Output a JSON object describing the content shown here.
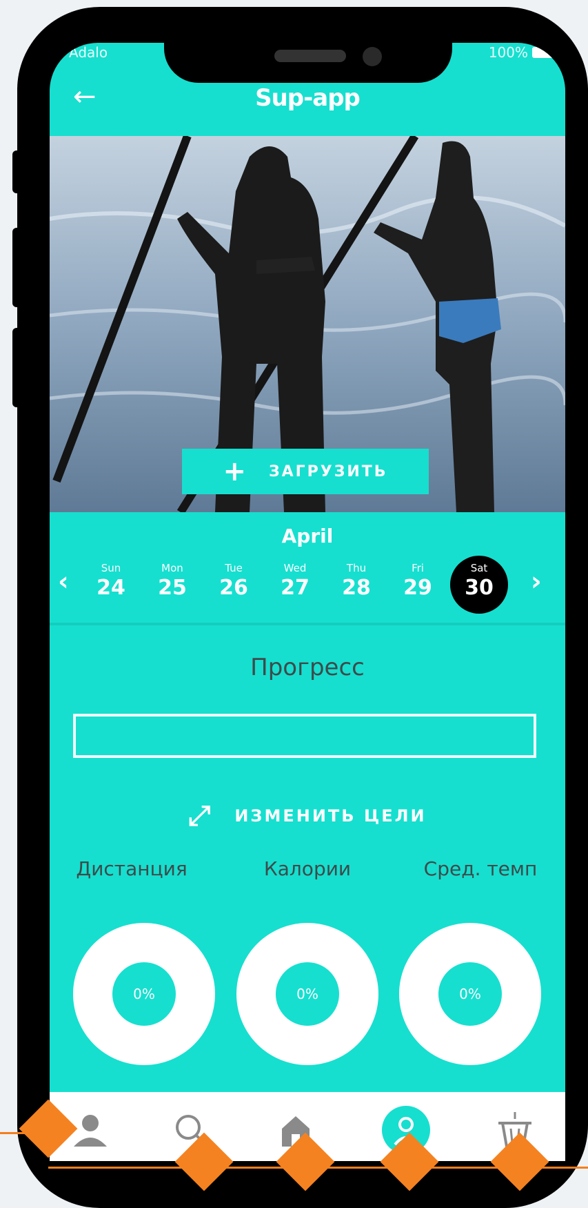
{
  "status": {
    "carrier": "Adalo",
    "battery": "100%"
  },
  "header": {
    "title": "Sup-app",
    "back_icon": "arrow-left-icon"
  },
  "hero": {
    "upload_label": "ЗАГРУЗИТЬ"
  },
  "calendar": {
    "month": "April",
    "days": [
      {
        "name": "Sun",
        "date": "24"
      },
      {
        "name": "Mon",
        "date": "25"
      },
      {
        "name": "Tue",
        "date": "26"
      },
      {
        "name": "Wed",
        "date": "27"
      },
      {
        "name": "Thu",
        "date": "28"
      },
      {
        "name": "Fri",
        "date": "29"
      },
      {
        "name": "Sat",
        "date": "30"
      }
    ],
    "selected_date": "30"
  },
  "progress": {
    "label": "Прогресс",
    "value_percent": 0
  },
  "goals": {
    "change_label": "ИЗМЕНИТЬ ЦЕЛИ"
  },
  "metrics": [
    {
      "label": "Дистанция",
      "value": "0%"
    },
    {
      "label": "Калории",
      "value": "0%"
    },
    {
      "label": "Сред. темп",
      "value": "0%"
    }
  ],
  "tabbar": {
    "items": [
      {
        "icon": "user-icon"
      },
      {
        "icon": "search-icon"
      },
      {
        "icon": "home-icon"
      },
      {
        "icon": "profile-icon",
        "active": true
      },
      {
        "icon": "basket-icon"
      }
    ]
  },
  "colors": {
    "accent": "#16dfcf",
    "decor": "#f58220"
  }
}
